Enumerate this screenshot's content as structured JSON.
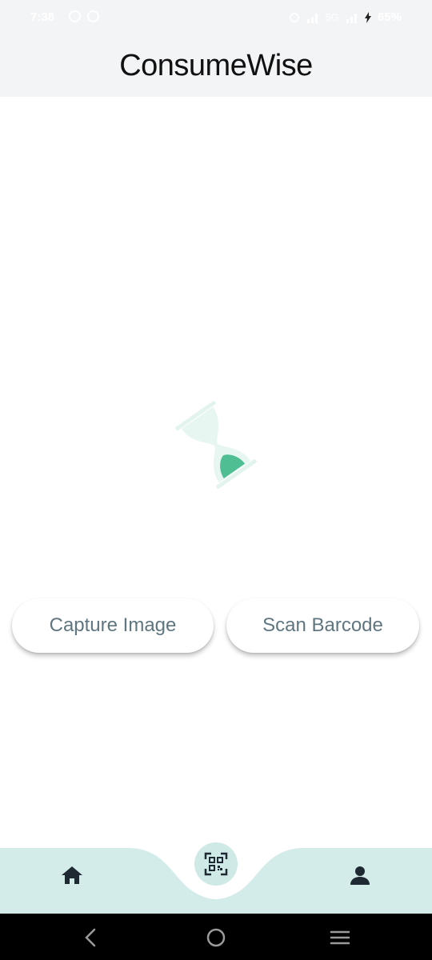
{
  "status_bar": {
    "time": "7:38",
    "network": "5G",
    "battery": "65%"
  },
  "header": {
    "title": "ConsumeWise"
  },
  "main": {
    "loader_icon": "hourglass-icon",
    "capture_label": "Capture Image",
    "scan_label": "Scan Barcode"
  },
  "bottom_nav": {
    "items": [
      {
        "icon": "home-icon"
      },
      {
        "icon": "qr-scan-icon"
      },
      {
        "icon": "person-icon"
      }
    ]
  },
  "system_nav": {
    "items": [
      "back-icon",
      "home-circle-icon",
      "recents-icon"
    ]
  },
  "colors": {
    "header_bg": "#f3f4f6",
    "nav_bg": "#d3ecea",
    "accent": "#4fbf93",
    "button_text": "#5f7681"
  }
}
